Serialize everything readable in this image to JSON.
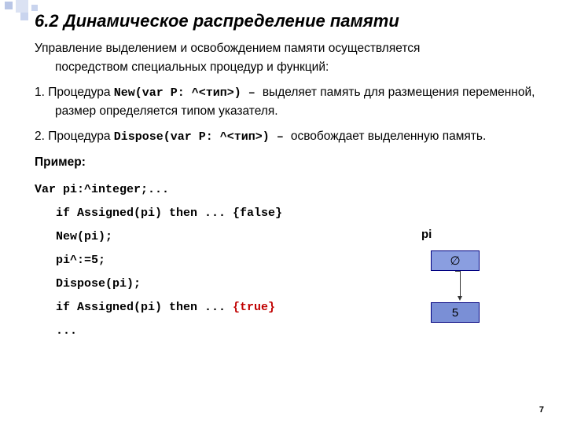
{
  "title": "6.2 Динамическое распределение памяти",
  "intro_l1": "Управление выделением и освобождением памяти осуществляется",
  "intro_l2": "посредством специальных процедур и функций:",
  "item1_prefix": "1. Процедура ",
  "item1_code": "New(var P: ^<тип>)",
  "item1_dash": " –  ",
  "item1_rest": "выделяет память для размещения переменной, размер определяется типом указателя.",
  "item2_prefix": "2. Процедура ",
  "item2_code": "Dispose(var P: ^<тип>)",
  "item2_dash": " – ",
  "item2_rest": "освобождает выделенную память.",
  "example_label": "Пример:",
  "code": {
    "l1a": "Var pi:^integer;",
    "l1b": "...",
    "l2": "   if Assigned(pi) then ... ",
    "l2_false": "{false}",
    "l3": "   New(pi);",
    "l4a": "   pi^:=5;",
    "l5": "   Dispose(pi);",
    "l6": "   if Assigned(pi) then ... ",
    "l6_true": "{true}",
    "l7": "   ..."
  },
  "diagram": {
    "label": "pi",
    "top_box": "∅",
    "bottom_box": "5"
  },
  "page_number": "7"
}
